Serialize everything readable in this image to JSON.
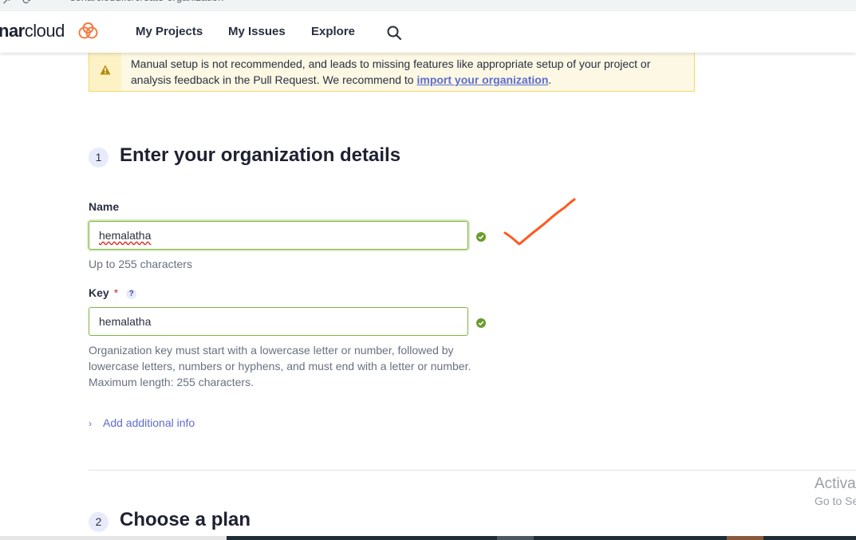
{
  "browser": {
    "url": "sonarcloud.io/create-organization"
  },
  "nav": {
    "logo_prefix": "nar",
    "logo_suffix": "cloud",
    "items": [
      {
        "label": "My Projects"
      },
      {
        "label": "My Issues"
      },
      {
        "label": "Explore"
      }
    ],
    "search_icon": "search-icon"
  },
  "warning": {
    "text_before": "Manual setup is not recommended, and leads to missing features like appropriate setup of your project or analysis feedback in the Pull Request. We recommend to ",
    "link": "import your organization",
    "text_after": ".",
    "icon": "warning-icon"
  },
  "step1": {
    "number": "1",
    "title": "Enter your organization details"
  },
  "name_field": {
    "label": "Name",
    "value": "hemalatha",
    "hint": "Up to 255 characters",
    "status_icon": "check-circle-icon"
  },
  "key_field": {
    "label": "Key",
    "required_mark": "*",
    "help": "?",
    "value": "hemalatha",
    "hint": "Organization key must start with a lowercase letter or number, followed by lowercase letters, numbers or hyphens, and must end with a letter or number. Maximum length: 255 characters.",
    "status_icon": "check-circle-icon"
  },
  "additional_info": {
    "label": "Add additional info",
    "icon": "chevron-right-icon"
  },
  "step2": {
    "number": "2",
    "title": "Choose a plan"
  },
  "watermark": {
    "line1": "Activa",
    "line2": "Go to Se"
  },
  "colors": {
    "accent": "#5d6cd0",
    "success": "#6a9c2b",
    "annotation": "#ff5a1f",
    "warning_border": "#f0d96b"
  }
}
